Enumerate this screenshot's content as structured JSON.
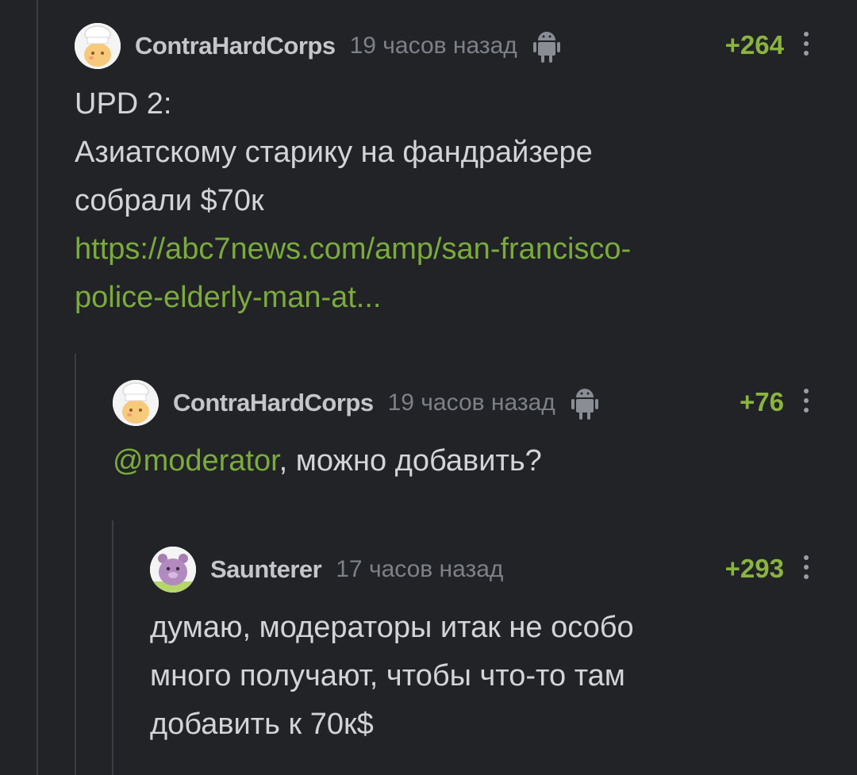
{
  "comments": [
    {
      "author": "ContraHardCorps",
      "time": "19 часов назад",
      "rating": "+264",
      "avatar_icon": "cook-avatar-icon",
      "device_icon": "android-icon",
      "line1": "UPD 2:",
      "line2": "Азиатскому старику на фандрайзере",
      "line3": "собрали $70к",
      "link_line1": "https://abc7news.com/amp/san-francisco-",
      "link_line2": "police-elderly-man-at..."
    },
    {
      "author": "ContraHardCorps",
      "time": "19 часов назад",
      "rating": "+76",
      "avatar_icon": "cook-avatar-icon",
      "device_icon": "android-icon",
      "mention": "@moderator",
      "text": ", можно добавить?"
    },
    {
      "author": "Saunterer",
      "time": "17 часов назад",
      "rating": "+293",
      "avatar_icon": "hamster-avatar-icon",
      "line1": "думаю, модераторы итак не особо",
      "line2": "много получают, чтобы что-то там",
      "line3": "добавить к 70к$"
    }
  ],
  "colors": {
    "background": "#212327",
    "author": "#c4c6ca",
    "time": "#7d8187",
    "rating": "#8ab43f",
    "link": "#7bab3a",
    "text": "#d2d4d7"
  }
}
